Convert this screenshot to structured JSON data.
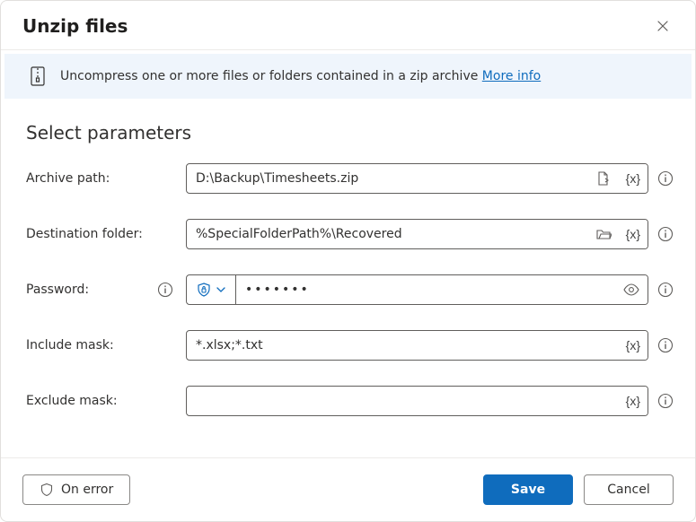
{
  "header": {
    "title": "Unzip files"
  },
  "banner": {
    "text": "Uncompress one or more files or folders contained in a zip archive ",
    "link_label": "More info"
  },
  "section_title": "Select parameters",
  "fields": {
    "archive_path": {
      "label": "Archive path:",
      "value": "D:\\Backup\\Timesheets.zip"
    },
    "destination": {
      "label": "Destination folder:",
      "value": "%SpecialFolderPath%\\Recovered"
    },
    "password": {
      "label": "Password:",
      "value": "•••••••"
    },
    "include_mask": {
      "label": "Include mask:",
      "value": "*.xlsx;*.txt"
    },
    "exclude_mask": {
      "label": "Exclude mask:",
      "value": ""
    }
  },
  "var_token": "{x}",
  "footer": {
    "on_error": "On error",
    "save": "Save",
    "cancel": "Cancel"
  }
}
